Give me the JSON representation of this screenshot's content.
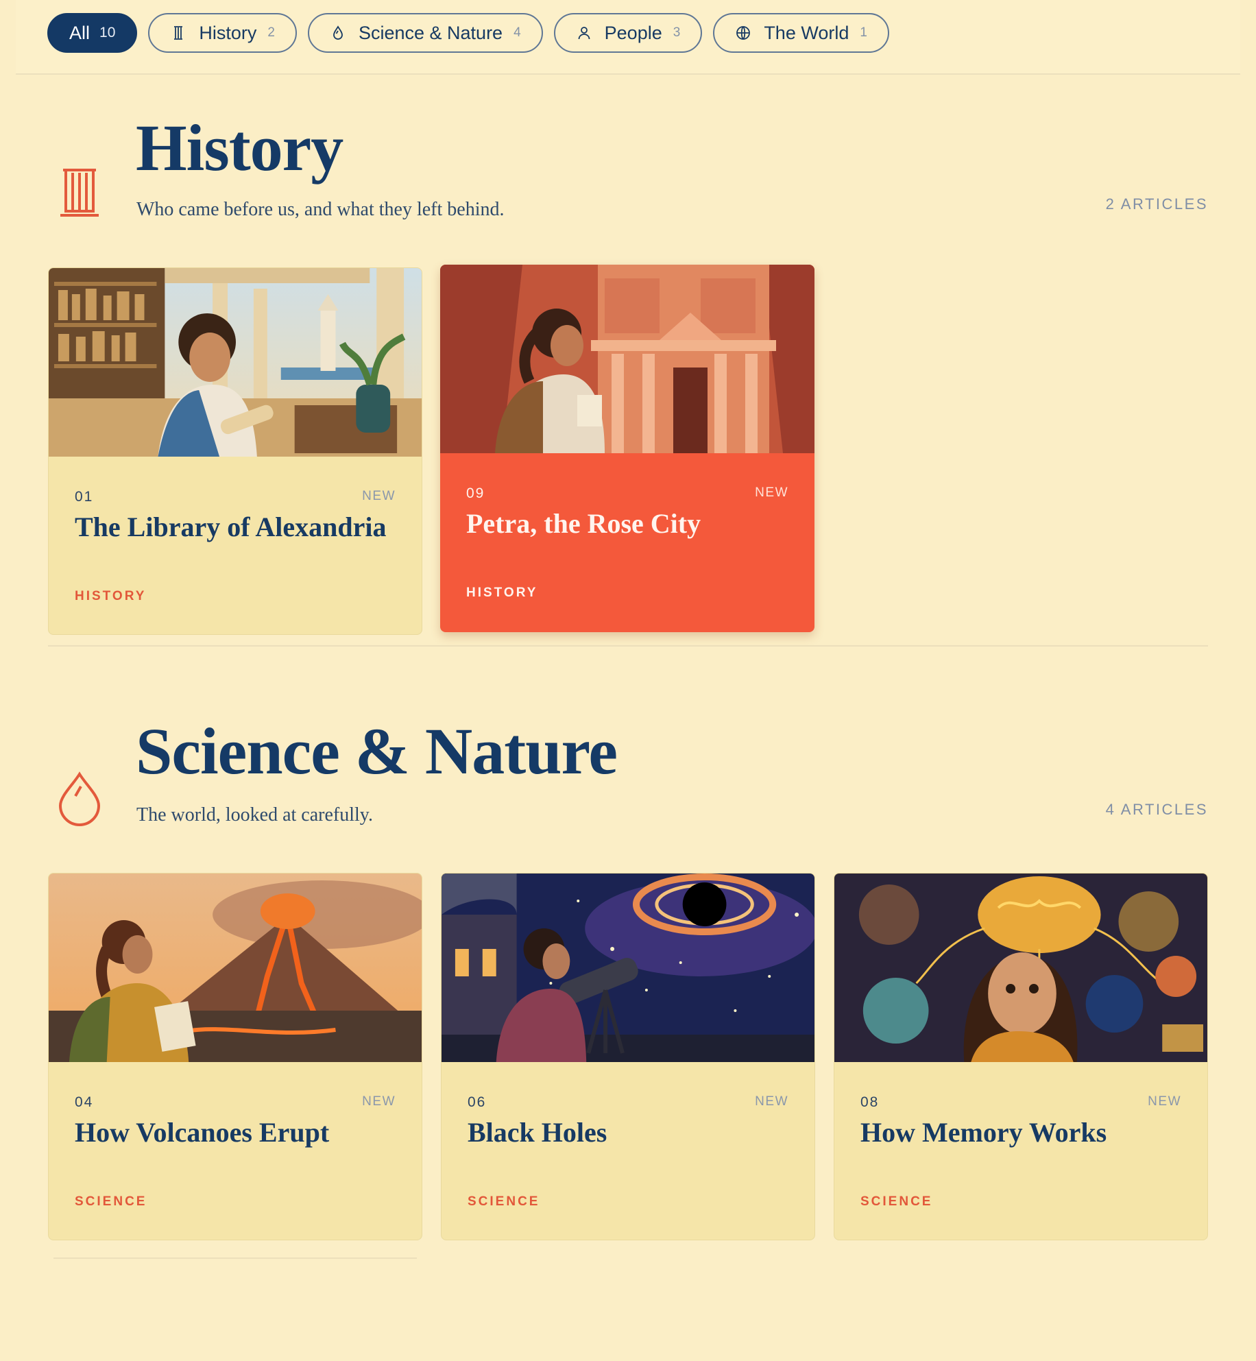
{
  "filters": [
    {
      "label": "All",
      "count": "10",
      "icon": "none",
      "active": true
    },
    {
      "label": "History",
      "count": "2",
      "icon": "column-icon"
    },
    {
      "label": "Science & Nature",
      "count": "4",
      "icon": "droplet-icon"
    },
    {
      "label": "People",
      "count": "3",
      "icon": "person-icon"
    },
    {
      "label": "The World",
      "count": "1",
      "icon": "globe-icon"
    }
  ],
  "sections": [
    {
      "title": "History",
      "subtitle": "Who came before us, and what they left behind.",
      "count": "2 ARTICLES",
      "icon": "column-icon",
      "cards": [
        {
          "num": "01",
          "badge": "NEW",
          "title": "The Library of Alexandria",
          "category": "HISTORY",
          "image": "library-of-alexandria-illustration"
        },
        {
          "num": "09",
          "badge": "NEW",
          "title": "Petra, the Rose City",
          "category": "HISTORY",
          "image": "petra-illustration"
        }
      ]
    },
    {
      "title": "Science & Nature",
      "subtitle": "The world, looked at carefully.",
      "count": "4 ARTICLES",
      "icon": "droplet-icon",
      "cards": [
        {
          "num": "04",
          "badge": "NEW",
          "title": "How Volcanoes Erupt",
          "category": "SCIENCE",
          "image": "volcano-illustration"
        },
        {
          "num": "06",
          "badge": "NEW",
          "title": "Black Holes",
          "category": "SCIENCE",
          "image": "black-hole-illustration"
        },
        {
          "num": "08",
          "badge": "NEW",
          "title": "How Memory Works",
          "category": "SCIENCE",
          "image": "memory-brain-illustration"
        }
      ]
    }
  ],
  "colors": {
    "background": "#fbeec6",
    "navy": "#153a66",
    "accent": "#f4593b",
    "card": "#f5e5a9"
  }
}
